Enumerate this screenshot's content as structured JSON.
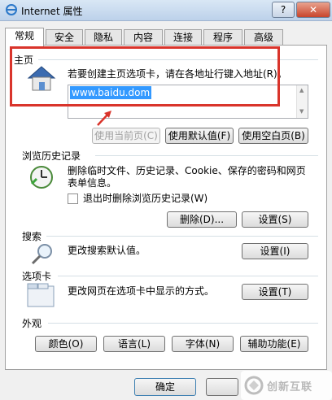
{
  "window": {
    "title": "Internet 属性",
    "help": "?",
    "close": "✕"
  },
  "tabs": [
    {
      "label": "常规",
      "active": true
    },
    {
      "label": "安全"
    },
    {
      "label": "隐私"
    },
    {
      "label": "内容"
    },
    {
      "label": "连接"
    },
    {
      "label": "程序"
    },
    {
      "label": "高级"
    }
  ],
  "homepage": {
    "section": "主页",
    "desc": "若要创建主页选项卡，请在各地址行键入地址(R)。",
    "url": "www.baidu.dom",
    "use_current": "使用当前页(C)",
    "use_default": "使用默认值(F)",
    "use_blank": "使用空白页(B)"
  },
  "history": {
    "section": "浏览历史记录",
    "desc1": "删除临时文件、历史记录、Cookie、保存的密码和网页",
    "desc2": "表单信息。",
    "checkbox": "退出时删除浏览历史记录(W)",
    "delete": "删除(D)...",
    "settings": "设置(S)"
  },
  "search": {
    "section": "搜索",
    "desc": "更改搜索默认值。",
    "settings": "设置(I)"
  },
  "tabs_section": {
    "section": "选项卡",
    "desc": "更改网页在选项卡中显示的方式。",
    "settings": "设置(T)"
  },
  "appearance": {
    "section": "外观",
    "colors": "颜色(O)",
    "languages": "语言(L)",
    "fonts": "字体(N)",
    "accessibility": "辅助功能(E)"
  },
  "footer": {
    "ok": "确定"
  },
  "watermark": {
    "text": "创新互联"
  },
  "colors": {
    "highlight": "#d9342b",
    "selection": "#3399ff"
  }
}
